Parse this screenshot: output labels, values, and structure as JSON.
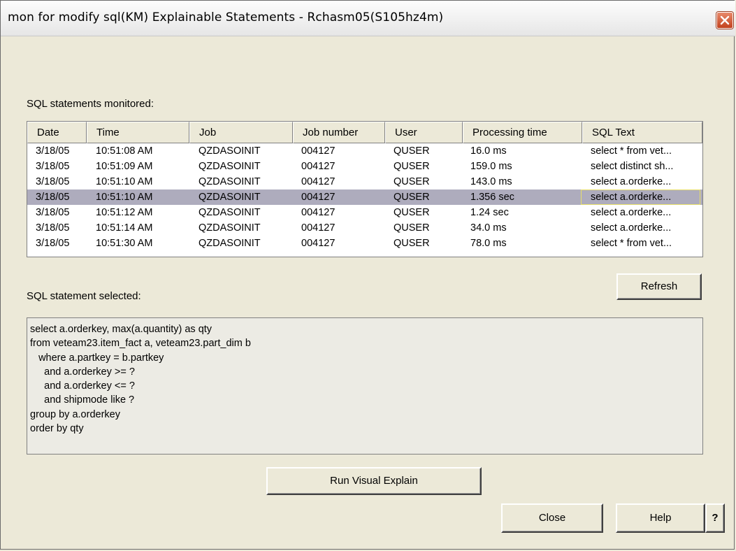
{
  "window": {
    "title": "mon for modify sql(KM) Explainable Statements - Rchasm05(S105hz4m)"
  },
  "monitored_label": "SQL statements monitored:",
  "table": {
    "columns": [
      "Date",
      "Time",
      "Job",
      "Job number",
      "User",
      "Processing time",
      "SQL Text"
    ],
    "rows": [
      [
        "3/18/05",
        "10:51:08 AM",
        "QZDASOINIT",
        "004127",
        "QUSER",
        "16.0 ms",
        "select * from vet..."
      ],
      [
        "3/18/05",
        "10:51:09 AM",
        "QZDASOINIT",
        "004127",
        "QUSER",
        "159.0 ms",
        "select distinct sh..."
      ],
      [
        "3/18/05",
        "10:51:10 AM",
        "QZDASOINIT",
        "004127",
        "QUSER",
        "143.0 ms",
        "select  a.orderke..."
      ],
      [
        "3/18/05",
        "10:51:10 AM",
        "QZDASOINIT",
        "004127",
        "QUSER",
        "1.356 sec",
        "select a.orderke..."
      ],
      [
        "3/18/05",
        "10:51:12 AM",
        "QZDASOINIT",
        "004127",
        "QUSER",
        "1.24 sec",
        "select a.orderke..."
      ],
      [
        "3/18/05",
        "10:51:14 AM",
        "QZDASOINIT",
        "004127",
        "QUSER",
        "34.0 ms",
        "select a.orderke..."
      ],
      [
        "3/18/05",
        "10:51:30 AM",
        "QZDASOINIT",
        "004127",
        "QUSER",
        "78.0 ms",
        "select * from vet..."
      ]
    ],
    "selected_row_index": 3
  },
  "selected_label": "SQL statement selected:",
  "refresh_label": "Refresh",
  "statement_lines": [
    "select a.orderkey, max(a.quantity) as qty",
    "from veteam23.item_fact a, veteam23.part_dim b",
    "   where a.partkey = b.partkey",
    "     and a.orderkey >= ?",
    "     and a.orderkey <= ?",
    "     and shipmode like ?",
    "group by a.orderkey",
    "order by qty"
  ],
  "buttons": {
    "run_visual_explain": "Run Visual Explain",
    "close": "Close",
    "help": "Help",
    "help_icon": "?"
  },
  "colors": {
    "dialog_bg": "#ece9d8",
    "selected_row": "#aeacbd",
    "focus_border": "#e7df6a",
    "close_button": "#c2411d"
  }
}
